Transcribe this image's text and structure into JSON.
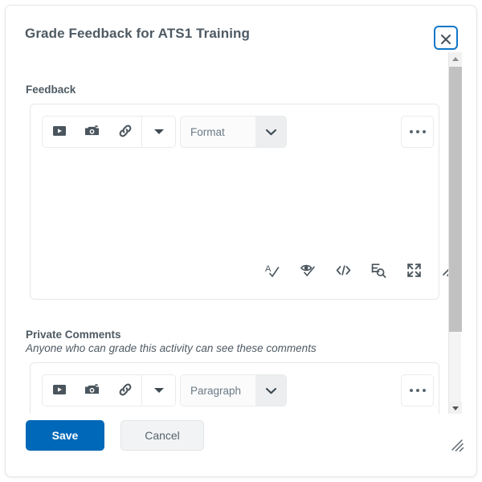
{
  "dialog": {
    "title": "Grade Feedback for ATS1 Training",
    "close_label": "Close",
    "close_icon": "close-icon"
  },
  "scrollbar": {
    "up_icon": "scroll-up-arrow-icon",
    "down_icon": "scroll-down-arrow-icon"
  },
  "sections": {
    "feedback": {
      "label": "Feedback",
      "editor": {
        "insert_stuff_icon": "insert-stuff-play-icon",
        "insert_image_icon": "insert-image-camera-icon",
        "quicklink_icon": "quicklink-chain-icon",
        "more_tools_icon": "toolbar-overflow-caret-icon",
        "format_value": "Format",
        "format_caret_icon": "chevron-down-icon",
        "more_label": "More Actions",
        "more_icon": "ellipsis-icon",
        "status": {
          "spellcheck_icon": "spellcheck-icon",
          "accessibility_icon": "accessibility-checker-icon",
          "html_source_icon": "html-source-code-icon",
          "word_count_icon": "word-count-icon",
          "fullscreen_icon": "fullscreen-expand-icon",
          "resize_icon": "editor-resize-handle-icon"
        }
      }
    },
    "private_comments": {
      "label": "Private Comments",
      "sublabel": "Anyone who can grade this activity can see these comments",
      "editor": {
        "insert_stuff_icon": "insert-stuff-play-icon",
        "insert_image_icon": "insert-image-camera-icon",
        "quicklink_icon": "quicklink-chain-icon",
        "more_tools_icon": "toolbar-overflow-caret-icon",
        "format_value": "Paragraph",
        "format_caret_icon": "chevron-down-icon",
        "more_label": "More Actions",
        "more_icon": "ellipsis-icon"
      }
    }
  },
  "footer": {
    "save_label": "Save",
    "cancel_label": "Cancel",
    "resize_icon": "dialog-resize-handle-icon"
  },
  "colors": {
    "primary_button": "#0068b8",
    "focus_ring": "#1177cb",
    "text": "#4e5a63",
    "muted_text": "#6a7a86",
    "border": "#e4e7e9"
  }
}
